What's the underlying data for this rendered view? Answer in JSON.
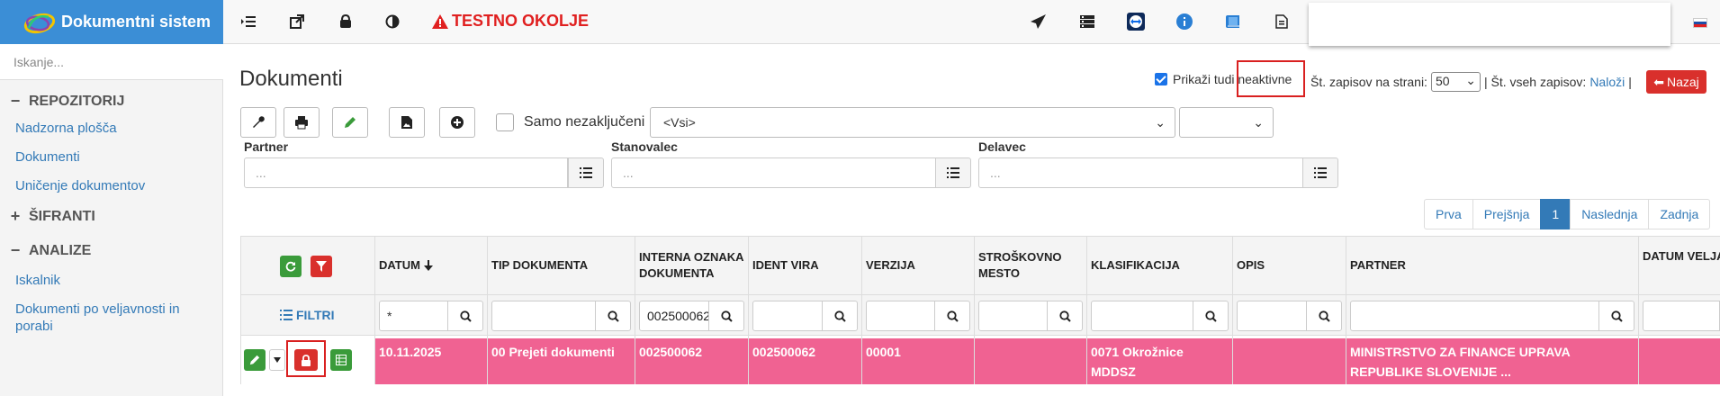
{
  "app": {
    "title": "Dokumentni sistem",
    "env_label": "TESTNO OKOLJE"
  },
  "topbar_icons": [
    "list-indent-icon",
    "external-link-icon",
    "bag-icon",
    "contrast-icon",
    "warning-icon",
    "paper-plane-icon",
    "server-icon",
    "teamviewer-icon",
    "info-icon",
    "book-icon",
    "document-icon",
    "slovenia-flag-icon"
  ],
  "sidebar": {
    "search_placeholder": "Iskanje...",
    "sections": [
      {
        "label": "REPOZITORIJ",
        "symbol": "−",
        "items": [
          "Nadzorna plošča",
          "Dokumenti",
          "Uničenje dokumentov"
        ]
      },
      {
        "label": "ŠIFRANTI",
        "symbol": "+",
        "items": []
      },
      {
        "label": "ANALIZE",
        "symbol": "−",
        "items": [
          "Iskalnik",
          "Dokumenti po veljavnosti in porabi"
        ]
      }
    ]
  },
  "page": {
    "title": "Dokumenti",
    "show_inactive": {
      "label": "Prikaži tudi neaktivne",
      "checked": true
    },
    "per_page": {
      "label": "Št. zapisov na strani:",
      "value": "50"
    },
    "total": {
      "label": "| Št. vseh zapisov:",
      "link": "Naloži",
      "sep": "|"
    },
    "back_label": "Nazaj"
  },
  "toolbar": {
    "only_unfinished_label": "Samo nezaključeni",
    "type_select": "<Vsi>",
    "second_select": ""
  },
  "filters": {
    "partner": {
      "label": "Partner",
      "placeholder": "..."
    },
    "tenant": {
      "label": "Stanovalec",
      "placeholder": "..."
    },
    "worker": {
      "label": "Delavec",
      "placeholder": "..."
    }
  },
  "pager": [
    "Prva",
    "Prejšnja",
    "1",
    "Naslednja",
    "Zadnja"
  ],
  "grid": {
    "filters_label": "FILTRI",
    "columns": [
      "DATUM",
      "TIP DOKUMENTA",
      "INTERNA OZNAKA DOKUMENTA",
      "IDENT VIRA",
      "VERZIJA",
      "STROŠKOVNO MESTO",
      "KLASIFIKACIJA",
      "OPIS",
      "PARTNER",
      "DATUM VELJAVNOSTI"
    ],
    "filter_values": [
      "*",
      "",
      "002500062",
      "",
      "",
      "",
      "",
      "",
      "",
      ""
    ],
    "row": [
      "10.11.2025",
      "00 Prejeti dokumenti",
      "002500062",
      "002500062",
      "00001",
      "",
      "0071 Okrožnice MDDSZ",
      "",
      "MINISTRSTVO ZA FINANCE UPRAVA REPUBLIKE SLOVENIJE ...",
      ""
    ]
  },
  "colors": {
    "brand": "#3b8ed6",
    "row_highlight": "#f06292",
    "danger": "#d9302c",
    "success": "#3a9b3a",
    "link": "#337ab7"
  }
}
